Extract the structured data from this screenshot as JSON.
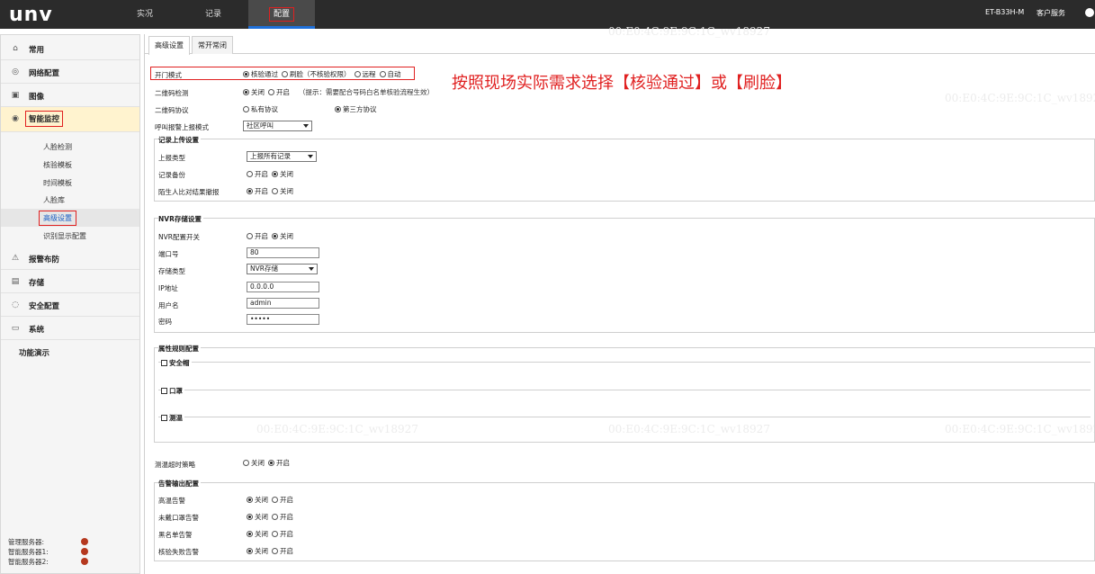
{
  "topbar": {
    "logo": "unv",
    "nav": {
      "live": "实况",
      "record": "记录",
      "config": "配置"
    },
    "device_name": "ET-B33H-M",
    "service": "客户服务"
  },
  "sidebar": {
    "items": {
      "common": "常用",
      "network": "网络配置",
      "image": "图像",
      "smart": "智能监控",
      "alarm": "报警布防",
      "storage": "存储",
      "security": "安全配置",
      "system": "系统",
      "demo": "功能演示"
    },
    "sub": {
      "face_detect": "人脸检测",
      "verify_template": "核验模板",
      "time_template": "时间模板",
      "face_lib": "人脸库",
      "advanced": "高级设置",
      "display": "识别显示配置"
    },
    "servers": [
      "管理服务器:",
      "智能服务器1:",
      "智能服务器2:"
    ]
  },
  "tabs": {
    "advanced": "高级设置",
    "normally_open": "常开常闭"
  },
  "form": {
    "door_mode": {
      "label": "开门模式",
      "options": [
        "核验通过",
        "刷脸（不核验权限）",
        "远程",
        "自动"
      ],
      "selected": 0
    },
    "qr_detect": {
      "label": "二维码检测",
      "options": [
        "关闭",
        "开启"
      ],
      "selected": 0,
      "hint": "（提示：需要配合号码白名单核验流程生效）"
    },
    "qr_protocol": {
      "label": "二维码协议",
      "options": [
        "私有协议",
        "第三方协议"
      ],
      "selected": 1
    },
    "call_mode": {
      "label": "呼叫报警上报模式",
      "value": "社区呼叫"
    },
    "record_upload": {
      "title": "记录上传设置",
      "type_label": "上报类型",
      "type_value": "上报所有记录",
      "backup": {
        "label": "记录备份",
        "options": [
          "开启",
          "关闭"
        ],
        "selected": 1
      },
      "stranger": {
        "label": "陌生人比对结果撤报",
        "options": [
          "开启",
          "关闭"
        ],
        "selected": 0
      }
    },
    "nvr": {
      "title": "NVR存储设置",
      "switch": {
        "label": "NVR配置开关",
        "options": [
          "开启",
          "关闭"
        ],
        "selected": 1
      },
      "port_label": "端口号",
      "port": "80",
      "storage_type_label": "存储类型",
      "storage_type": "NVR存储",
      "ip_label": "IP地址",
      "ip": "0.0.0.0",
      "user_label": "用户名",
      "user": "admin",
      "pwd_label": "密码",
      "pwd": "•••••"
    },
    "attr": {
      "title": "属性规则配置",
      "helmet": "安全帽",
      "mask": "口罩",
      "temp": "测温"
    },
    "temp_timeout": {
      "label": "测温超时策略",
      "options": [
        "关闭",
        "开启"
      ],
      "selected": 1
    },
    "alarm_out": {
      "title": "告警输出配置",
      "rows": [
        {
          "label": "高温告警",
          "options": [
            "关闭",
            "开启"
          ],
          "selected": 0
        },
        {
          "label": "未戴口罩告警",
          "options": [
            "关闭",
            "开启"
          ],
          "selected": 0
        },
        {
          "label": "黑名单告警",
          "options": [
            "关闭",
            "开启"
          ],
          "selected": 0
        },
        {
          "label": "核验失败告警",
          "options": [
            "关闭",
            "开启"
          ],
          "selected": 0
        }
      ]
    }
  },
  "watermark": "00:E0:4C:9E:9C:1C_wv18927",
  "annotation": "按照现场实际需求选择【核验通过】或【刷脸】",
  "colors": {
    "topbar": "#2b2b2b",
    "accent": "#1e6fd9",
    "highlight": "#e02020",
    "server_dot": "#b5381e"
  }
}
